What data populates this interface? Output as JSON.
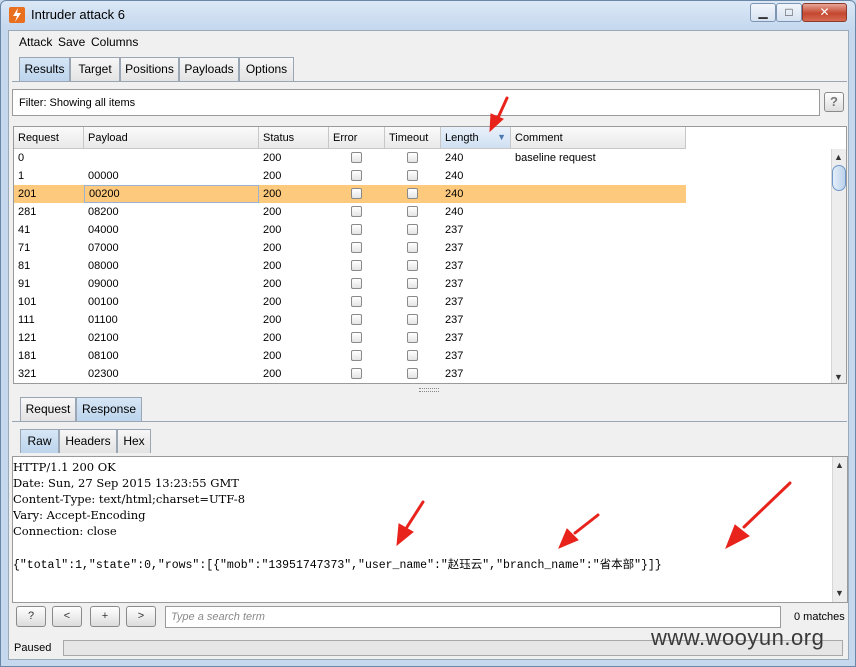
{
  "window": {
    "title": "Intruder attack 6"
  },
  "menu": [
    "Attack",
    "Save",
    "Columns"
  ],
  "main_tabs": [
    {
      "label": "Results",
      "active": true
    },
    {
      "label": "Target",
      "active": false
    },
    {
      "label": "Positions",
      "active": false
    },
    {
      "label": "Payloads",
      "active": false
    },
    {
      "label": "Options",
      "active": false
    }
  ],
  "filter": {
    "text": "Filter: Showing all items",
    "help": "?"
  },
  "table": {
    "columns": [
      "Request",
      "Payload",
      "Status",
      "Error",
      "Timeout",
      "Length",
      "Comment"
    ],
    "sorted_column": "Length",
    "rows": [
      {
        "request": "0",
        "payload": "",
        "status": "200",
        "error": false,
        "timeout": false,
        "length": "240",
        "comment": "baseline request",
        "selected": false
      },
      {
        "request": "1",
        "payload": "00000",
        "status": "200",
        "error": false,
        "timeout": false,
        "length": "240",
        "comment": "",
        "selected": false
      },
      {
        "request": "201",
        "payload": "00200",
        "status": "200",
        "error": false,
        "timeout": false,
        "length": "240",
        "comment": "",
        "selected": true
      },
      {
        "request": "281",
        "payload": "08200",
        "status": "200",
        "error": false,
        "timeout": false,
        "length": "240",
        "comment": "",
        "selected": false
      },
      {
        "request": "41",
        "payload": "04000",
        "status": "200",
        "error": false,
        "timeout": false,
        "length": "237",
        "comment": "",
        "selected": false
      },
      {
        "request": "71",
        "payload": "07000",
        "status": "200",
        "error": false,
        "timeout": false,
        "length": "237",
        "comment": "",
        "selected": false
      },
      {
        "request": "81",
        "payload": "08000",
        "status": "200",
        "error": false,
        "timeout": false,
        "length": "237",
        "comment": "",
        "selected": false
      },
      {
        "request": "91",
        "payload": "09000",
        "status": "200",
        "error": false,
        "timeout": false,
        "length": "237",
        "comment": "",
        "selected": false
      },
      {
        "request": "101",
        "payload": "00100",
        "status": "200",
        "error": false,
        "timeout": false,
        "length": "237",
        "comment": "",
        "selected": false
      },
      {
        "request": "111",
        "payload": "01100",
        "status": "200",
        "error": false,
        "timeout": false,
        "length": "237",
        "comment": "",
        "selected": false
      },
      {
        "request": "121",
        "payload": "02100",
        "status": "200",
        "error": false,
        "timeout": false,
        "length": "237",
        "comment": "",
        "selected": false
      },
      {
        "request": "181",
        "payload": "08100",
        "status": "200",
        "error": false,
        "timeout": false,
        "length": "237",
        "comment": "",
        "selected": false
      },
      {
        "request": "321",
        "payload": "02300",
        "status": "200",
        "error": false,
        "timeout": false,
        "length": "237",
        "comment": "",
        "selected": false
      }
    ]
  },
  "detail_tabs": [
    {
      "label": "Request",
      "active": false
    },
    {
      "label": "Response",
      "active": true
    }
  ],
  "view_tabs": [
    {
      "label": "Raw",
      "active": true
    },
    {
      "label": "Headers",
      "active": false
    },
    {
      "label": "Hex",
      "active": false
    }
  ],
  "response": {
    "lines": [
      "HTTP/1.1 200 OK",
      "Date: Sun, 27 Sep 2015 13:23:55 GMT",
      "Content-Type: text/html;charset=UTF-8",
      "Vary: Accept-Encoding",
      "Connection: close"
    ],
    "body": "{\"total\":1,\"state\":0,\"rows\":[{\"mob\":\"13951747373\",\"user_name\":\"赵珏云\",\"branch_name\":\"省本部\"}]}"
  },
  "search": {
    "help": "?",
    "prev": "<",
    "add": "+",
    "next": ">",
    "placeholder": "Type a search term",
    "matches": "0 matches"
  },
  "status": {
    "text": "Paused",
    "progress": 0
  },
  "watermark": "www.wooyun.org",
  "colors": {
    "selected_row": "#fdc97c",
    "annotation_arrow": "#e8231c",
    "active_tab": "#c8dcf0"
  }
}
